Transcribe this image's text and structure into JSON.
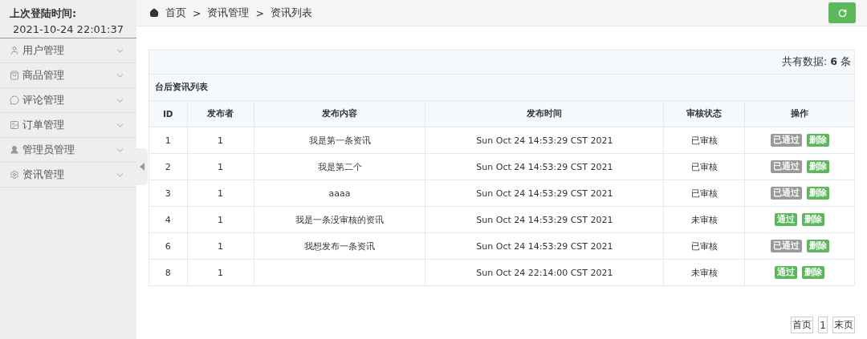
{
  "sidebar": {
    "last_login_label": "上次登陆时间:",
    "last_login_time": "2021-10-24 22:01:37",
    "items": [
      {
        "label": "用户管理"
      },
      {
        "label": "商品管理"
      },
      {
        "label": "评论管理"
      },
      {
        "label": "订单管理"
      },
      {
        "label": "管理员管理"
      },
      {
        "label": "资讯管理"
      }
    ]
  },
  "breadcrumb": [
    "首页",
    "资讯管理",
    "资讯列表"
  ],
  "breadcrumb_separator": ">",
  "summary": {
    "prefix": "共有数据:",
    "count": "6",
    "suffix": "条"
  },
  "table": {
    "caption": "台后资讯列表",
    "columns": [
      "ID",
      "发布者",
      "发布内容",
      "发布时间",
      "审核状态",
      "操作"
    ],
    "rows": [
      {
        "cells": [
          "1",
          "1",
          "我是第一条资讯",
          "Sun Oct 24 14:53:29 CST 2021",
          "已审核"
        ],
        "actions": [
          {
            "label": "已通过",
            "kind": "done"
          },
          {
            "label": "删除",
            "kind": "delete"
          }
        ]
      },
      {
        "cells": [
          "2",
          "1",
          "我是第二个",
          "Sun Oct 24 14:53:29 CST 2021",
          "已审核"
        ],
        "actions": [
          {
            "label": "已通过",
            "kind": "done"
          },
          {
            "label": "删除",
            "kind": "delete"
          }
        ]
      },
      {
        "cells": [
          "3",
          "1",
          "aaaa",
          "Sun Oct 24 14:53:29 CST 2021",
          "已审核"
        ],
        "actions": [
          {
            "label": "已通过",
            "kind": "done"
          },
          {
            "label": "删除",
            "kind": "delete"
          }
        ]
      },
      {
        "cells": [
          "4",
          "1",
          "我是一条没审核的资讯",
          "Sun Oct 24 14:53:29 CST 2021",
          "未审核"
        ],
        "actions": [
          {
            "label": "通过",
            "kind": "approve"
          },
          {
            "label": "删除",
            "kind": "delete"
          }
        ]
      },
      {
        "cells": [
          "6",
          "1",
          "我想发布一条资讯",
          "Sun Oct 24 14:53:29 CST 2021",
          "已审核"
        ],
        "actions": [
          {
            "label": "已通过",
            "kind": "done"
          },
          {
            "label": "删除",
            "kind": "delete"
          }
        ]
      },
      {
        "cells": [
          "8",
          "1",
          "",
          "Sun Oct 24 22:14:00 CST 2021",
          "未审核"
        ],
        "actions": [
          {
            "label": "通过",
            "kind": "approve"
          },
          {
            "label": "删除",
            "kind": "delete"
          }
        ]
      }
    ]
  },
  "pagination": [
    "首页",
    "1",
    "末页"
  ]
}
